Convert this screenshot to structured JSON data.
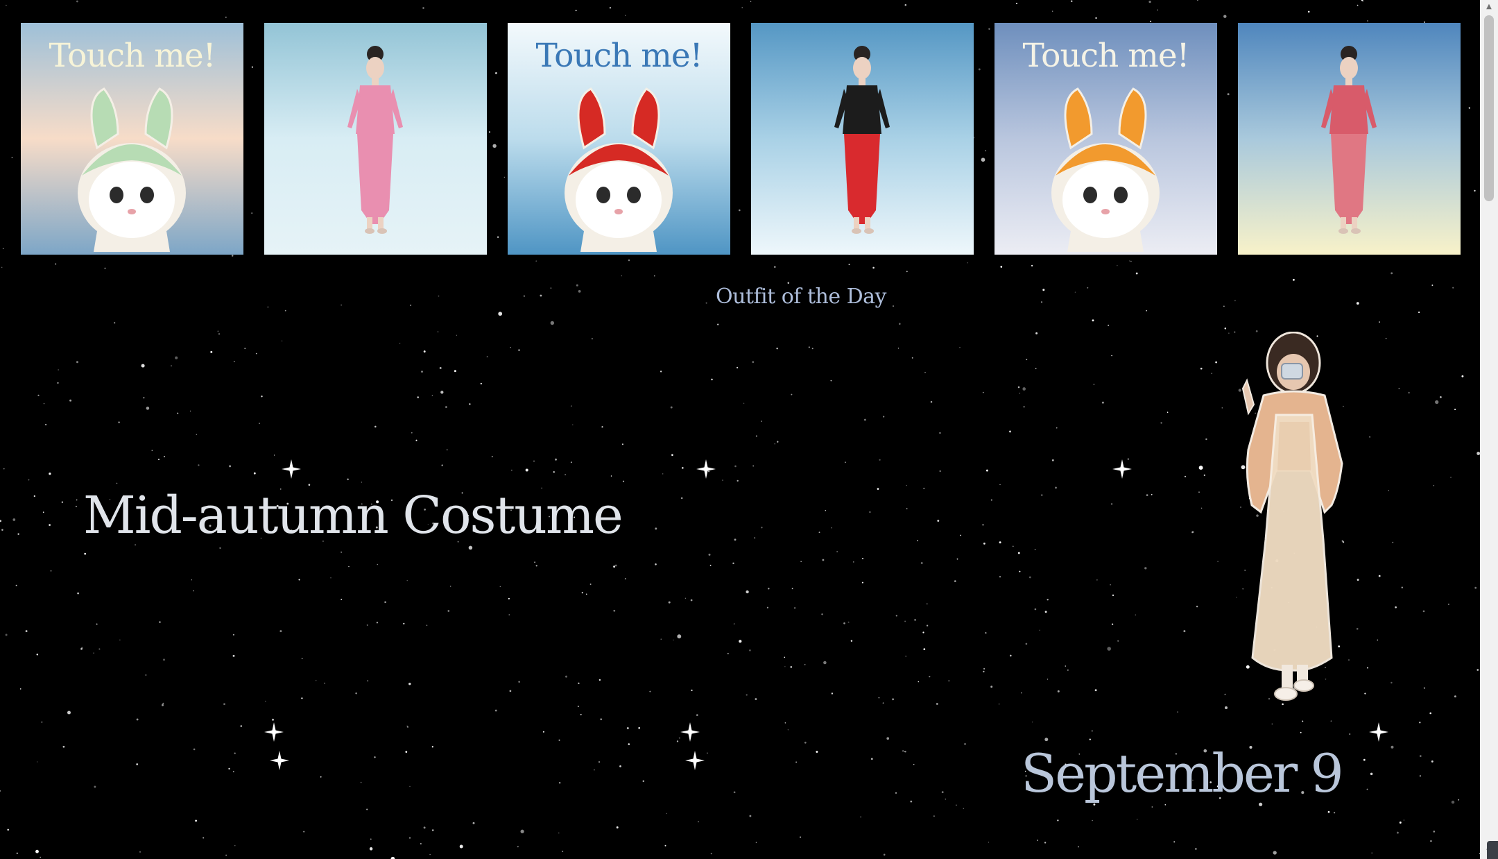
{
  "gallery": {
    "cards": [
      {
        "label": "Touch me!",
        "kind": "cat",
        "hat": "green-bunny-hat",
        "label_color": "#f7f4d8",
        "gradient": [
          "#9ec0d8",
          "#f7dcc8",
          "#7da6c7"
        ]
      },
      {
        "label": "",
        "kind": "model",
        "outfit": "pink-tweed-dress",
        "gradient": [
          "#93c4d6",
          "#d8edf4",
          "#e6f3f7"
        ]
      },
      {
        "label": "Touch me!",
        "kind": "cat",
        "hat": "red-crab-hat",
        "label_color": "#3a78b6",
        "gradient": [
          "#f3f9fc",
          "#bcdcec",
          "#4f95c4"
        ]
      },
      {
        "label": "",
        "kind": "model",
        "outfit": "black-top-red-pants",
        "gradient": [
          "#5597c4",
          "#a9d1e6",
          "#eef7fb"
        ]
      },
      {
        "label": "Touch me!",
        "kind": "cat",
        "hat": "orange-bunny-hat",
        "label_color": "#f5f3e6",
        "gradient": [
          "#6e8fbd",
          "#b9c6de",
          "#ecedf4"
        ]
      },
      {
        "label": "",
        "kind": "model",
        "outfit": "red-gingham-dress",
        "gradient": [
          "#4f86bd",
          "#a9c9dc",
          "#f8f2c9"
        ]
      }
    ]
  },
  "main": {
    "subtitle": "Outfit of the Day",
    "title": "Mid-autumn Costume",
    "date": "September 9"
  },
  "colors": {
    "background": "#000000",
    "subtitle": "#aebedb",
    "title": "#e0e4ea",
    "date": "#b9c6da"
  }
}
